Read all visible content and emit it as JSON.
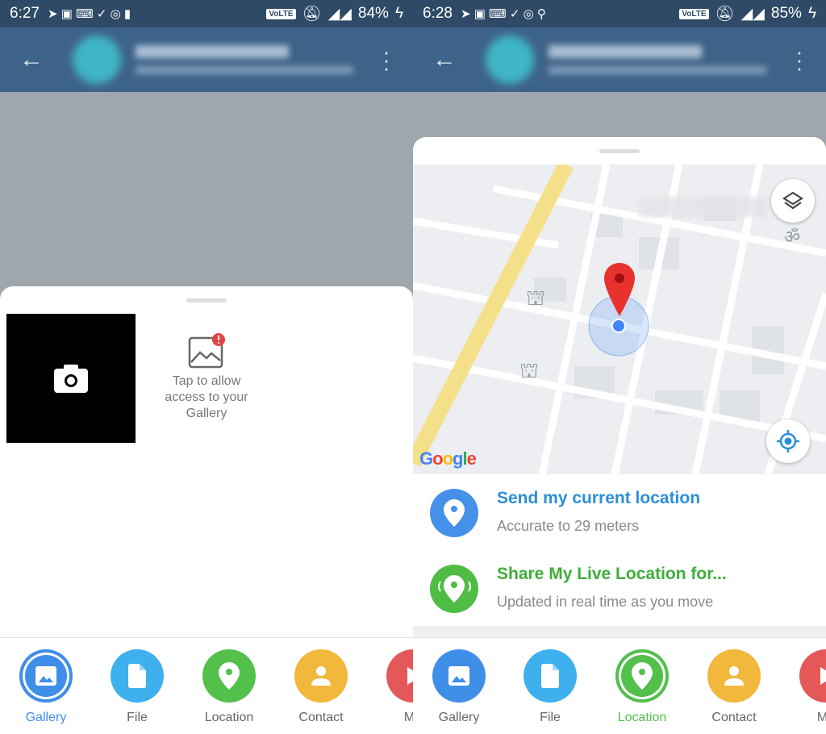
{
  "left": {
    "status": {
      "time": "6:27",
      "battery": "84%"
    },
    "gallery_permission": {
      "text": "Tap to allow access to your Gallery"
    },
    "attach": [
      {
        "label": "Gallery",
        "color": "#3f8ee8",
        "icon": "image-icon",
        "selected": true
      },
      {
        "label": "File",
        "color": "#3eb0ee",
        "icon": "file-icon"
      },
      {
        "label": "Location",
        "color": "#52c04b",
        "icon": "location-pin-icon"
      },
      {
        "label": "Contact",
        "color": "#f2b83c",
        "icon": "person-icon"
      },
      {
        "label": "Mu",
        "color": "#e55858",
        "icon": "play-icon"
      }
    ]
  },
  "right": {
    "status": {
      "time": "6:28",
      "battery": "85%"
    },
    "map": {
      "logo": "Google"
    },
    "send_current": {
      "title": "Send my current location",
      "subtitle": "Accurate to 29 meters",
      "color": "#2a8fd8"
    },
    "share_live": {
      "title": "Share My Live Location for...",
      "subtitle": "Updated in real time as you move",
      "color": "#3fae3a"
    },
    "attach": [
      {
        "label": "Gallery",
        "color": "#3f8ee8",
        "icon": "image-icon"
      },
      {
        "label": "File",
        "color": "#3eb0ee",
        "icon": "file-icon"
      },
      {
        "label": "Location",
        "color": "#52c04b",
        "icon": "location-pin-icon",
        "selected": true
      },
      {
        "label": "Contact",
        "color": "#f2b83c",
        "icon": "person-icon"
      },
      {
        "label": "Mu",
        "color": "#e55858",
        "icon": "play-icon"
      }
    ]
  }
}
